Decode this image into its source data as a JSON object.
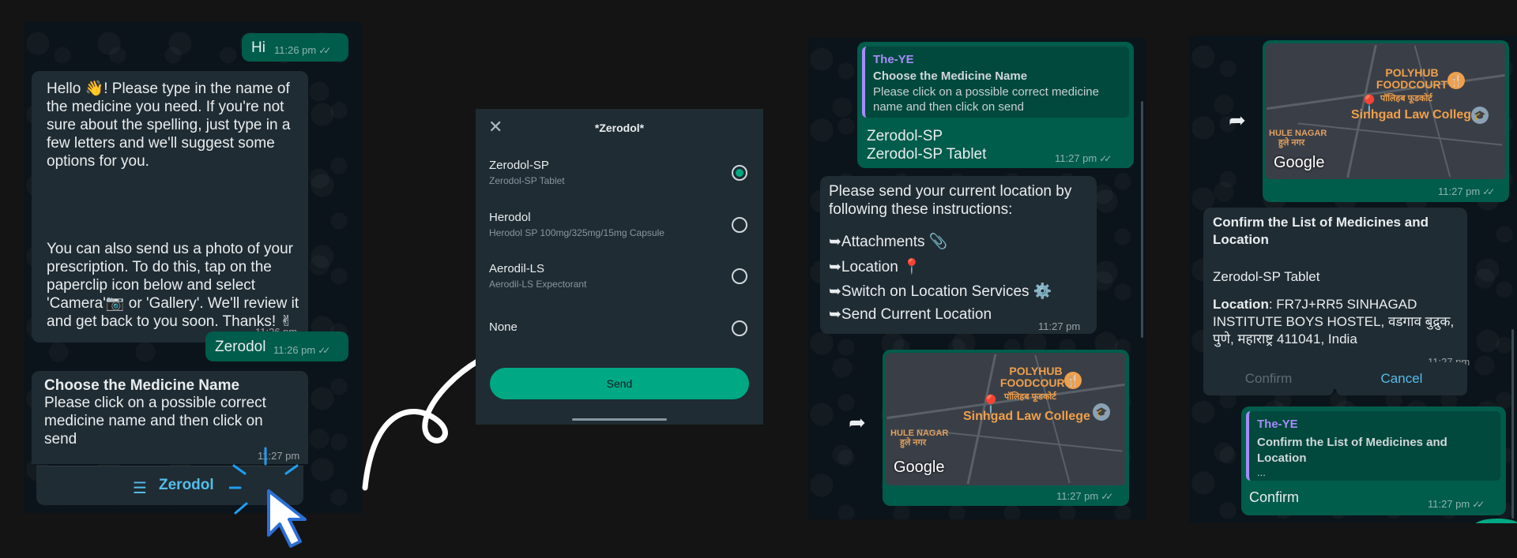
{
  "chat1": {
    "hi_text": "Hi",
    "hi_time": "11:26 pm",
    "welcome_p1": "Hello 👋! Please type in the name of the medicine you need. If you're not sure about the spelling, just type in a few letters and we'll suggest some options for you.",
    "welcome_p2": "You can also send us a photo of your prescription. To do this, tap on the paperclip icon below and select 'Camera'📷 or 'Gallery'. We'll review it and get back to you soon. Thanks! ✌",
    "welcome_time": "11:26 pm",
    "zerodol_text": "Zerodol",
    "zerodol_time": "11:26 pm",
    "choose_title": "Choose the Medicine Name",
    "choose_body": "Please click on a possible correct medicine name and then click on send",
    "choose_time": "11:27 pm",
    "list_button": "Zerodol"
  },
  "modal": {
    "title": "*Zerodol*",
    "options": [
      {
        "title": "Zerodol-SP",
        "subtitle": "Zerodol-SP Tablet",
        "selected": true
      },
      {
        "title": "Herodol",
        "subtitle": "Herodol SP 100mg/325mg/15mg Capsule",
        "selected": false
      },
      {
        "title": "Aerodil-LS",
        "subtitle": "Aerodil-LS Expectorant",
        "selected": false
      },
      {
        "title": "None",
        "subtitle": "",
        "selected": false
      }
    ],
    "send_label": "Send"
  },
  "chat3": {
    "quote_sender": "The-YE",
    "quote_title": "Choose the Medicine Name",
    "quote_body": "Please click on a possible correct medicine name and then click on send",
    "reply_line1": "Zerodol-SP",
    "reply_line2": "Zerodol-SP Tablet",
    "reply_time": "11:27 pm",
    "location_intro": "Please send your current location by following these instructions:",
    "step1": "➥Attachments 📎",
    "step2": "➥Location 📍",
    "step3": "➥Switch on Location Services ⚙️",
    "step4": "➥Send Current Location",
    "location_time": "11:27 pm",
    "map_place1": "POLYHUB FOODCOURT",
    "map_place1_hi": "पॉलिहब फूडकोर्ट",
    "map_place2": "Sinhgad Law College",
    "map_place3": "HULE NAGAR",
    "map_place3_hi": "हुले नगर",
    "map_brand": "Google",
    "map_time": "11:27 pm"
  },
  "chat4": {
    "map_time": "11:27 pm",
    "confirm_title": "Confirm the List of Medicines and Location",
    "confirm_item": "Zerodol-SP Tablet",
    "location_label": "Location",
    "location_value": ": FR7J+RR5 SINHAGAD INSTITUTE BOYS HOSTEL, वडगाव बुद्रुक, पुणे, महाराष्ट्र 411041, India",
    "confirm_time": "11:27 pm",
    "confirm_btn": "Confirm",
    "cancel_btn": "Cancel",
    "quote_sender": "The-YE",
    "quote_title": "Confirm the List of Medicines and Location",
    "quote_more": "...",
    "reply_text": "Confirm",
    "reply_time": "11:27 pm"
  },
  "colors": {
    "background": "#141414",
    "chat_bg": "#0b141a",
    "incoming": "#202c33",
    "outgoing": "#005c4b",
    "accent": "#00a884",
    "link": "#53bdeb"
  }
}
